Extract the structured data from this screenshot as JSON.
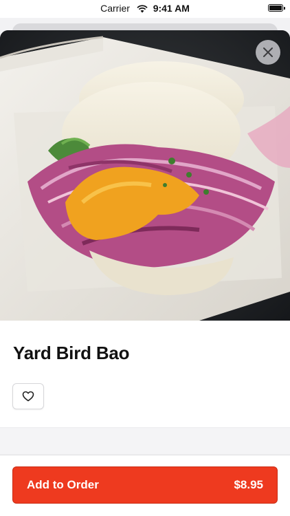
{
  "status_bar": {
    "carrier": "Carrier",
    "time": "9:41 AM"
  },
  "item": {
    "name": "Yard Bird Bao",
    "image_alt": "Yard Bird Bao photo"
  },
  "actions": {
    "add_label": "Add to Order",
    "price": "$8.95"
  },
  "icons": {
    "wifi": "wifi-icon",
    "battery": "battery-icon",
    "close": "close-icon",
    "favorite": "heart-icon"
  },
  "colors": {
    "accent": "#ee3a1f",
    "accent_border": "#c92a12",
    "text": "#111111"
  }
}
